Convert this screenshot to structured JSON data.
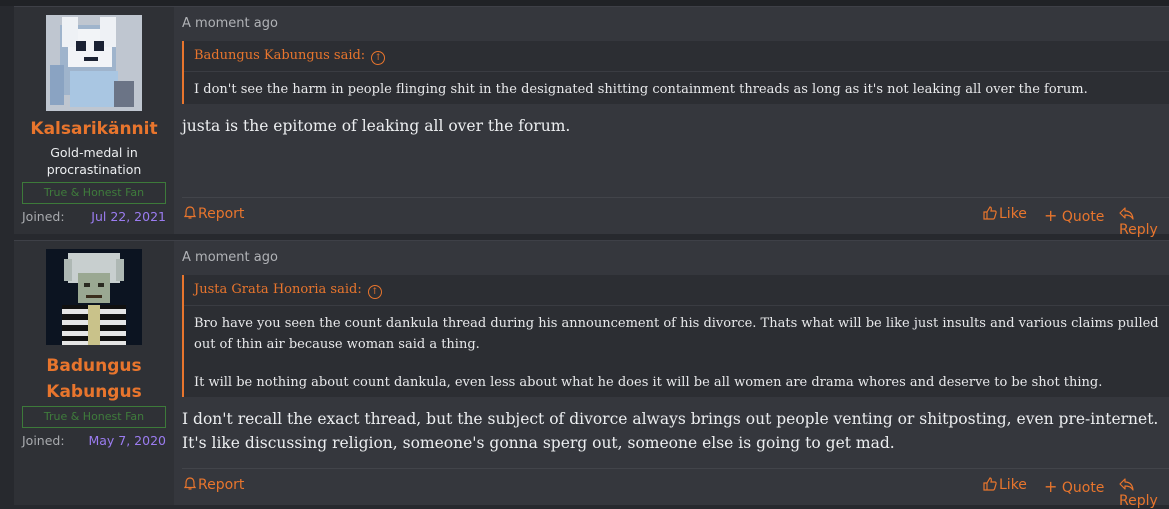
{
  "posts": [
    {
      "author": "Kalsarikännit",
      "user_title": "Gold-medal in procrastination",
      "banner": "True & Honest Fan",
      "joined_label": "Joined:",
      "joined_date": "Jul 22, 2021",
      "date": "A moment ago",
      "quote_author": "Badungus Kabungus said:",
      "quote_text": "I don't see the harm in people flinging shit in the designated shitting containment threads as long as it's not leaking all over the forum.",
      "message": "justa is the epitome of leaking all over the forum.",
      "actions": {
        "report": "Report",
        "like": "Like",
        "quote": "Quote",
        "reply": "Reply"
      }
    },
    {
      "author": "Badungus Kabungus",
      "banner": "True & Honest Fan",
      "joined_label": "Joined:",
      "joined_date": "May 7, 2020",
      "date": "A moment ago",
      "quote_author": "Justa Grata Honoria said:",
      "quote_paragraphs": [
        "Bro have you seen the count dankula thread during his announcement of his divorce. Thats what will be like just insults and various claims pulled out of thin air because woman said a thing.",
        "It will be nothing about count dankula, even less about what he does it will be all women are drama whores and deserve to be shot thing."
      ],
      "message": "I don't recall the exact thread, but the subject of divorce always brings out people venting or shitposting, even pre-internet. It's like discussing religion, someone's gonna sperg out, someone else is going to get mad.",
      "actions": {
        "report": "Report",
        "like": "Like",
        "quote": "Quote",
        "reply": "Reply"
      }
    }
  ]
}
